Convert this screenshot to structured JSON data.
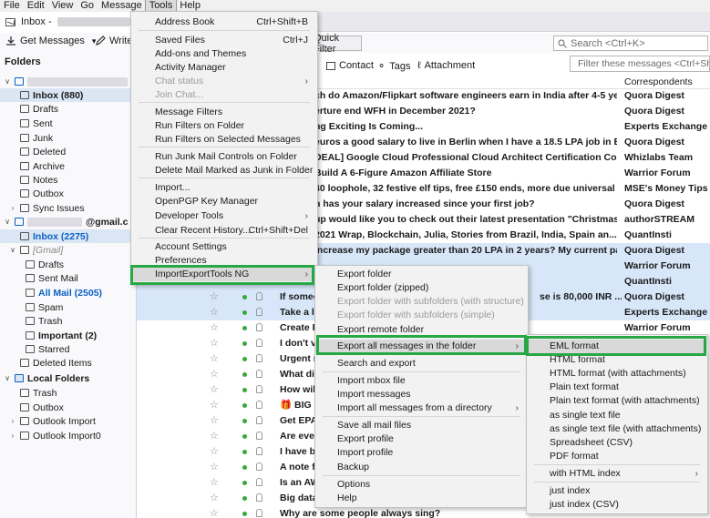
{
  "menubar": [
    "File",
    "Edit",
    "View",
    "Go",
    "Message",
    "Tools",
    "Help"
  ],
  "tab": {
    "title": "Inbox - "
  },
  "toolbar": {
    "get_messages": "Get Messages",
    "write": "Write",
    "quick_filter": "Quick Filter",
    "search_placeholder": "Search <Ctrl+K>"
  },
  "quickfilter_bar": {
    "contact": "Contact",
    "tags": "Tags",
    "attachment": "Attachment",
    "filter_placeholder": "Filter these messages <Ctrl+Shift"
  },
  "folders": {
    "header": "Folders",
    "account1": "",
    "account1_folders": [
      "Inbox (880)",
      "Drafts",
      "Sent",
      "Junk",
      "Deleted",
      "Archive",
      "Notes",
      "Outbox",
      "Sync Issues"
    ],
    "account2": "@gmail.c",
    "account2_inbox": "Inbox (2275)",
    "gmail_group": "[Gmail]",
    "gmail_folders": [
      "Drafts",
      "Sent Mail",
      "All Mail (2505)",
      "Spam",
      "Trash",
      "Important (2)",
      "Starred",
      "Deleted Items"
    ],
    "local": "Local Folders",
    "local_folders": [
      "Trash",
      "Outbox",
      "Outlook Import",
      "Outlook Import0"
    ]
  },
  "messages": {
    "correspondents_header": "Correspondents",
    "rows": [
      {
        "subject": "ch do Amazon/Flipkart software engineers earn in India after 4-5 yea...",
        "from": "Quora Digest"
      },
      {
        "subject": "erture end WFH in December 2021?",
        "from": "Quora Digest"
      },
      {
        "subject": "ng Exciting Is Coming...",
        "from": "Experts Exchange"
      },
      {
        "subject": "euros a good salary to live in Berlin when I have a 18.5 LPA job in Be...",
        "from": "Quora Digest"
      },
      {
        "subject": "DEAL] Google Cloud Professional Cloud Architect Certification Course...",
        "from": "Whizlabs Team"
      },
      {
        "subject": "Build A 6-Figure Amazon Affiliate Store",
        "from": "Warrior Forum"
      },
      {
        "subject": "40 loophole, 32 festive elf tips, free £150 ends, more due universal ...",
        "from": "MSE's Money Tips"
      },
      {
        "subject": "h has your salary increased since your first job?",
        "from": "Quora Digest"
      },
      {
        "subject": "up would like you to check out their latest presentation \"Christmas ...",
        "from": "authorSTREAM"
      },
      {
        "subject": "2021 Wrap, Blockchain, Julia, Stories from Brazil, India, Spain an...",
        "from": "QuantInsti"
      },
      {
        "subject": "increase my package greater than 20 LPA in 2 years? My current pac...",
        "from": "Quora Digest"
      },
      {
        "subject": "",
        "from": "Warrior Forum"
      },
      {
        "subject": "",
        "from": "QuantInsti"
      },
      {
        "subject": "If somec",
        "tail": "se is 80,000 INR ...",
        "from": "Quora Digest"
      },
      {
        "subject": "Take a lo",
        "from": "Experts Exchange"
      },
      {
        "subject": "Create R",
        "from": "Warrior Forum"
      },
      {
        "subject": "I don't v",
        "from": ""
      },
      {
        "subject": "Urgent r",
        "from": ""
      },
      {
        "subject": "What di",
        "from": ""
      },
      {
        "subject": "How wil",
        "from": ""
      },
      {
        "subject": "BIG",
        "from": ""
      },
      {
        "subject": "Get EPA",
        "from": ""
      },
      {
        "subject": "Are ever",
        "from": ""
      },
      {
        "subject": "I have b",
        "from": ""
      },
      {
        "subject": "A note f",
        "from": ""
      },
      {
        "subject": "Is an AW",
        "from": ""
      },
      {
        "subject": "Big data",
        "from": ""
      },
      {
        "subject": "Why are some people always sing?",
        "from": ""
      }
    ]
  },
  "tools_menu": {
    "items": [
      {
        "label": "Address Book",
        "shortcut": "Ctrl+Shift+B"
      },
      {
        "label": "Saved Files",
        "shortcut": "Ctrl+J"
      },
      {
        "label": "Add-ons and Themes"
      },
      {
        "label": "Activity Manager"
      },
      {
        "label": "Chat status",
        "disabled": true
      },
      {
        "label": "Join Chat...",
        "disabled": true
      },
      {
        "label": "Message Filters"
      },
      {
        "label": "Run Filters on Folder"
      },
      {
        "label": "Run Filters on Selected Messages"
      },
      {
        "label": "Run Junk Mail Controls on Folder"
      },
      {
        "label": "Delete Mail Marked as Junk in Folder"
      },
      {
        "label": "Import..."
      },
      {
        "label": "OpenPGP Key Manager"
      },
      {
        "label": "Developer Tools"
      },
      {
        "label": "Clear Recent History...",
        "shortcut": "Ctrl+Shift+Del"
      },
      {
        "label": "Account Settings"
      },
      {
        "label": "Preferences"
      },
      {
        "label": "ImportExportTools NG"
      }
    ]
  },
  "iet_menu": {
    "items": [
      {
        "label": "Export folder"
      },
      {
        "label": "Export folder (zipped)"
      },
      {
        "label": "Export folder with subfolders (with structure)",
        "disabled": true
      },
      {
        "label": "Export folder with subfolders (simple)",
        "disabled": true
      },
      {
        "label": "Export remote folder"
      },
      {
        "label": "Export all messages in the folder"
      },
      {
        "label": "Search and export"
      },
      {
        "label": "Import mbox file"
      },
      {
        "label": "Import messages"
      },
      {
        "label": "Import all messages from a directory"
      },
      {
        "label": "Save all mail files"
      },
      {
        "label": "Export profile"
      },
      {
        "label": "Import profile"
      },
      {
        "label": "Backup"
      },
      {
        "label": "Options"
      },
      {
        "label": "Help"
      }
    ]
  },
  "format_menu": {
    "items": [
      {
        "label": "EML format"
      },
      {
        "label": "HTML format"
      },
      {
        "label": "HTML format (with attachments)"
      },
      {
        "label": "Plain text format"
      },
      {
        "label": "Plain text format (with attachments)"
      },
      {
        "label": "as single text file"
      },
      {
        "label": "as single text file (with attachments)"
      },
      {
        "label": "Spreadsheet (CSV)"
      },
      {
        "label": "PDF format"
      },
      {
        "label": "with HTML index"
      },
      {
        "label": "just index"
      },
      {
        "label": "just index (CSV)"
      }
    ]
  },
  "colors": {
    "highlight_green": "#28a745",
    "selection_blue": "#d7e6f8",
    "accent_blue": "#0a60c4"
  }
}
